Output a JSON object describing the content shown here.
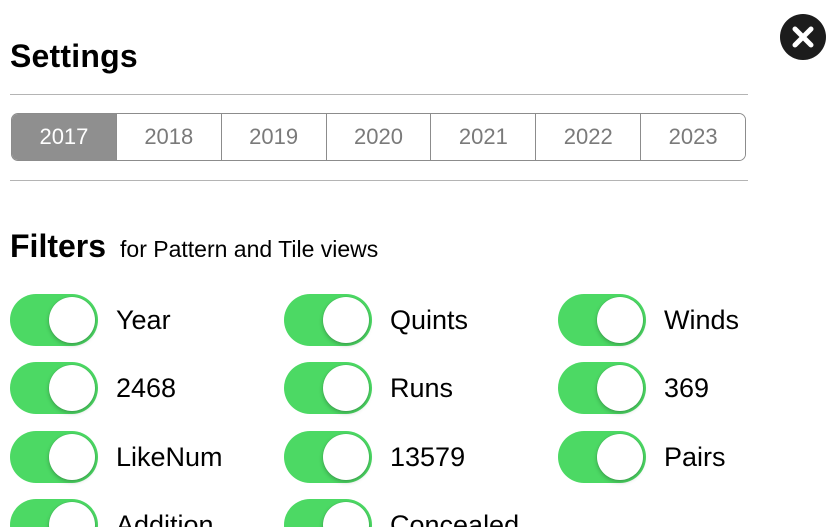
{
  "header": {
    "title": "Settings",
    "close_icon": "close-circle-icon"
  },
  "year_selector": {
    "selected": "2017",
    "years": [
      "2017",
      "2018",
      "2019",
      "2020",
      "2021",
      "2022",
      "2023"
    ]
  },
  "filters": {
    "heading": "Filters",
    "subheading": "for Pattern and Tile views",
    "accent_color": "#4cd964",
    "toggles": [
      {
        "label": "Year",
        "on": true
      },
      {
        "label": "Quints",
        "on": true
      },
      {
        "label": "Winds",
        "on": true
      },
      {
        "label": "2468",
        "on": true
      },
      {
        "label": "Runs",
        "on": true
      },
      {
        "label": "369",
        "on": true
      },
      {
        "label": "LikeNum",
        "on": true
      },
      {
        "label": "13579",
        "on": true
      },
      {
        "label": "Pairs",
        "on": true
      },
      {
        "label": "Addition",
        "on": true
      },
      {
        "label": "Concealed",
        "on": true
      }
    ]
  }
}
